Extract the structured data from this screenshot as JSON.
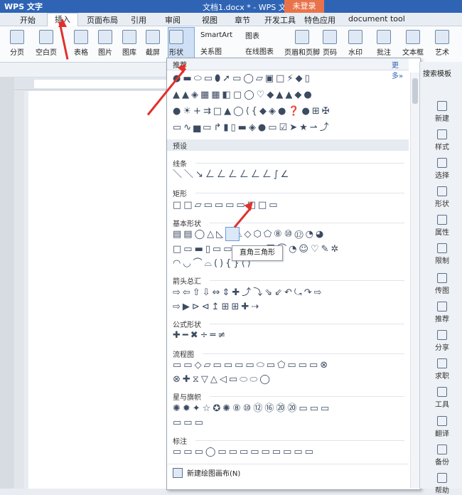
{
  "titlebar": {
    "app": "WPS 文字",
    "doc": "文档1.docx * - WPS 文字",
    "login": "未登录"
  },
  "menubar": {
    "items": [
      "开始",
      "插入",
      "页面布局",
      "引用",
      "审阅",
      "视图",
      "章节",
      "开发工具",
      "特色应用",
      "document tool"
    ],
    "active": "插入"
  },
  "ribbon": {
    "buttons": [
      "分页",
      "空白页",
      "表格",
      "图片",
      "图库",
      "截屏",
      "形状",
      "SmartArt",
      "图表",
      "关系图",
      "在线图表",
      "页眉和页脚",
      "页码",
      "水印",
      "批注",
      "文本框",
      "艺术"
    ]
  },
  "panel": {
    "recommend": "推荐",
    "more": "更多»",
    "preset": "预设",
    "sections": [
      "线条",
      "矩形",
      "基本形状",
      "箭头总汇",
      "公式形状",
      "流程图",
      "星与旗帜",
      "标注"
    ],
    "new_canvas": "新建绘图画布(N)",
    "tooltip": "直角三角形",
    "rows": {
      "r1": "●▬⬭▭⬮➚▭◯▱▣□⚡◆▯",
      "r2": "▲▲◈▦▦◧▢◯♡◆▲▲◆●",
      "r3": "●☀+⇉□▲◯⟨{◆◈●❓●⊞✠",
      "r4": "▭∿▅▭↱▮▯▬◈●▭☑➤★⇀⤴",
      "lines": "＼＼↘ㄥㄥㄥㄥㄥㄥ∫∠",
      "rect": "□□▱▭▭▭▭□□▭",
      "basic1": "▤▤◯△◺▱⏢◇⬡⬠⑧⑩⑫◔◕",
      "basic2": "□▭▬▯▭▭▭▣◎◙⌒◔☺♡✎✲",
      "basic3": "◠◡⌒⌓(){}⟨⟩",
      "arrows1": "⇨⇦⇧⇩⇔⇕✚⤴⤵⇘⇙↶⤿↷⇨",
      "arrows2": "⇨▶⊳⊲↥⊞⊞✚⇢",
      "formula": "✚━✖÷═≠",
      "flow1": "▭▭◇▱▭▭▭▭⬭▭⬠▭▭▭⊗",
      "flow2": "⊗✚⧖▽△◁▭⬭⬭◯",
      "stars1": "✺✹✦☆✪✺⑧⑩⑫⑯⑳⑳▭▭▭",
      "stars2": "▭▭▭",
      "callouts": "▭▭▭◯▭▭▭▭▭▭▭▭▭"
    }
  },
  "rightpane": {
    "title": "搜索模板",
    "items": [
      "新建",
      "样式",
      "选择",
      "形状",
      "属性",
      "限制",
      "传图",
      "推荐",
      "分享",
      "求职",
      "工具",
      "翻译",
      "备份",
      "帮助"
    ]
  }
}
